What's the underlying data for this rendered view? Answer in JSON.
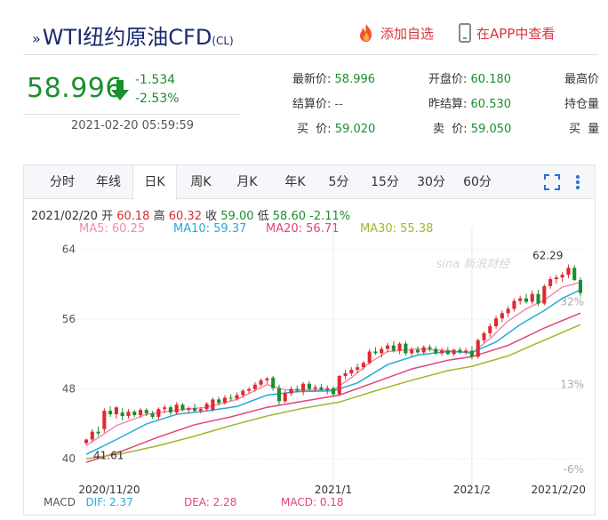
{
  "header": {
    "title_main": "WTI纽约原油CFD",
    "title_sub": "(CL)",
    "add_watch_label": "添加自选",
    "app_label": "在APP中查看"
  },
  "quote": {
    "price": "58.996",
    "change": "-1.534",
    "change_pct": "-2.53%",
    "time": "2021-02-20 05:59:59"
  },
  "fields": [
    {
      "label": "最新价:",
      "value": "58.996"
    },
    {
      "label": "开盘价:",
      "value": "60.180"
    },
    {
      "label": "最高价",
      "value": ""
    },
    {
      "label": "结算价:",
      "value": "--"
    },
    {
      "label": "昨结算:",
      "value": "60.530"
    },
    {
      "label": "持仓量",
      "value": ""
    },
    {
      "label": "买  价:",
      "value": "59.020"
    },
    {
      "label": "卖  价:",
      "value": "59.050"
    },
    {
      "label": "买  量",
      "value": ""
    }
  ],
  "tabs": [
    "分时",
    "年线",
    "日K",
    "周K",
    "月K",
    "年K",
    "5分",
    "15分",
    "30分",
    "60分"
  ],
  "active_tab": "日K",
  "info": {
    "date": "2021/02/20",
    "open_label": "开",
    "open": "60.18",
    "high_label": "高",
    "high": "60.32",
    "close_label": "收",
    "close": "59.00",
    "low_label": "低",
    "low": "58.60",
    "change_pct": "-2.11%"
  },
  "ma": [
    {
      "label": "MA5: 60.25",
      "color": "#f08bb0"
    },
    {
      "label": "MA10: 59.37",
      "color": "#27a9d9"
    },
    {
      "label": "MA20: 56.71",
      "color": "#e0457a"
    },
    {
      "label": "MA30: 55.38",
      "color": "#a3b52a"
    }
  ],
  "macd": {
    "macd_label": "MACD",
    "dif": "DIF: 2.37",
    "dea": "DEA: 2.28",
    "macd": "MACD: 0.18"
  },
  "watermark": "新浪财经",
  "chart_data": {
    "type": "candlestick",
    "ylim": [
      39.5,
      65.5
    ],
    "y_ticks": [
      "64",
      "56",
      "48",
      "40"
    ],
    "y_tick_values": [
      64,
      56,
      48,
      40
    ],
    "right_ticks": [
      "32%",
      "13%",
      "-6%"
    ],
    "x_ticks": [
      "2020/11/20",
      "2021/1",
      "2021/2",
      "2021/2/20"
    ],
    "x_tick_index": [
      0,
      41,
      64,
      93
    ],
    "annotations": {
      "high_label": "62.29",
      "low_label": "41.61"
    },
    "candles": [
      {
        "o": 41.8,
        "h": 42.3,
        "l": 41.6,
        "c": 42.2
      },
      {
        "o": 42.2,
        "h": 43.4,
        "l": 41.9,
        "c": 43.1
      },
      {
        "o": 43.1,
        "h": 43.7,
        "l": 42.6,
        "c": 42.9
      },
      {
        "o": 43.4,
        "h": 45.8,
        "l": 43.0,
        "c": 45.5
      },
      {
        "o": 45.5,
        "h": 46.0,
        "l": 44.8,
        "c": 45.1
      },
      {
        "o": 45.1,
        "h": 46.0,
        "l": 44.6,
        "c": 45.9
      },
      {
        "o": 45.3,
        "h": 45.8,
        "l": 44.4,
        "c": 44.9
      },
      {
        "o": 44.9,
        "h": 45.7,
        "l": 44.6,
        "c": 45.4
      },
      {
        "o": 45.4,
        "h": 45.6,
        "l": 44.8,
        "c": 45.0
      },
      {
        "o": 45.0,
        "h": 45.8,
        "l": 44.7,
        "c": 45.6
      },
      {
        "o": 45.6,
        "h": 45.8,
        "l": 44.9,
        "c": 45.2
      },
      {
        "o": 45.2,
        "h": 45.5,
        "l": 44.6,
        "c": 44.8
      },
      {
        "o": 44.8,
        "h": 45.9,
        "l": 44.5,
        "c": 45.7
      },
      {
        "o": 45.7,
        "h": 46.2,
        "l": 45.2,
        "c": 45.9
      },
      {
        "o": 45.9,
        "h": 46.1,
        "l": 45.0,
        "c": 45.3
      },
      {
        "o": 45.3,
        "h": 46.5,
        "l": 45.0,
        "c": 46.2
      },
      {
        "o": 46.2,
        "h": 46.4,
        "l": 45.4,
        "c": 45.6
      },
      {
        "o": 45.6,
        "h": 46.0,
        "l": 45.2,
        "c": 45.8
      },
      {
        "o": 45.8,
        "h": 46.3,
        "l": 45.3,
        "c": 45.5
      },
      {
        "o": 45.5,
        "h": 45.9,
        "l": 45.2,
        "c": 45.7
      },
      {
        "o": 45.7,
        "h": 46.5,
        "l": 45.4,
        "c": 46.3
      },
      {
        "o": 45.6,
        "h": 47.0,
        "l": 45.4,
        "c": 46.8
      },
      {
        "o": 46.8,
        "h": 47.1,
        "l": 46.1,
        "c": 46.4
      },
      {
        "o": 46.4,
        "h": 47.3,
        "l": 46.2,
        "c": 47.0
      },
      {
        "o": 47.0,
        "h": 47.4,
        "l": 46.6,
        "c": 46.9
      },
      {
        "o": 46.9,
        "h": 47.6,
        "l": 46.7,
        "c": 47.3
      },
      {
        "o": 47.3,
        "h": 48.0,
        "l": 47.0,
        "c": 47.8
      },
      {
        "o": 47.8,
        "h": 48.2,
        "l": 47.5,
        "c": 48.0
      },
      {
        "o": 48.0,
        "h": 48.8,
        "l": 47.7,
        "c": 48.5
      },
      {
        "o": 48.5,
        "h": 49.2,
        "l": 48.3,
        "c": 49.0
      },
      {
        "o": 49.0,
        "h": 49.4,
        "l": 48.6,
        "c": 49.2
      },
      {
        "o": 49.3,
        "h": 49.5,
        "l": 47.8,
        "c": 48.1
      },
      {
        "o": 48.1,
        "h": 48.5,
        "l": 46.2,
        "c": 46.6
      },
      {
        "o": 46.6,
        "h": 47.8,
        "l": 46.4,
        "c": 47.5
      },
      {
        "o": 47.5,
        "h": 48.3,
        "l": 47.2,
        "c": 48.0
      },
      {
        "o": 48.0,
        "h": 48.4,
        "l": 47.6,
        "c": 47.8
      },
      {
        "o": 47.8,
        "h": 48.8,
        "l": 47.3,
        "c": 48.6
      },
      {
        "o": 48.6,
        "h": 48.9,
        "l": 47.8,
        "c": 48.0
      },
      {
        "o": 48.0,
        "h": 48.5,
        "l": 47.7,
        "c": 48.2
      },
      {
        "o": 48.2,
        "h": 48.6,
        "l": 47.8,
        "c": 47.9
      },
      {
        "o": 47.9,
        "h": 48.4,
        "l": 47.4,
        "c": 48.1
      },
      {
        "o": 48.1,
        "h": 48.3,
        "l": 47.1,
        "c": 47.4
      },
      {
        "o": 47.4,
        "h": 49.6,
        "l": 47.2,
        "c": 49.5
      },
      {
        "o": 49.5,
        "h": 50.2,
        "l": 49.1,
        "c": 49.8
      },
      {
        "o": 49.8,
        "h": 50.5,
        "l": 49.5,
        "c": 50.2
      },
      {
        "o": 50.2,
        "h": 50.9,
        "l": 49.8,
        "c": 50.5
      },
      {
        "o": 50.5,
        "h": 51.2,
        "l": 50.2,
        "c": 51.0
      },
      {
        "o": 51.0,
        "h": 52.6,
        "l": 50.8,
        "c": 52.3
      },
      {
        "o": 52.3,
        "h": 52.8,
        "l": 51.9,
        "c": 52.1
      },
      {
        "o": 52.1,
        "h": 52.9,
        "l": 51.6,
        "c": 52.6
      },
      {
        "o": 52.6,
        "h": 53.3,
        "l": 52.2,
        "c": 53.0
      },
      {
        "o": 53.0,
        "h": 53.5,
        "l": 52.2,
        "c": 52.4
      },
      {
        "o": 52.4,
        "h": 53.4,
        "l": 52.0,
        "c": 53.2
      },
      {
        "o": 53.2,
        "h": 53.5,
        "l": 51.8,
        "c": 52.1
      },
      {
        "o": 52.1,
        "h": 52.8,
        "l": 51.7,
        "c": 52.5
      },
      {
        "o": 52.5,
        "h": 52.9,
        "l": 52.0,
        "c": 52.2
      },
      {
        "o": 52.2,
        "h": 53.0,
        "l": 51.9,
        "c": 52.8
      },
      {
        "o": 52.8,
        "h": 53.1,
        "l": 52.3,
        "c": 52.6
      },
      {
        "o": 52.6,
        "h": 52.9,
        "l": 51.9,
        "c": 52.1
      },
      {
        "o": 52.1,
        "h": 52.7,
        "l": 51.8,
        "c": 52.4
      },
      {
        "o": 52.4,
        "h": 52.8,
        "l": 51.9,
        "c": 52.0
      },
      {
        "o": 52.0,
        "h": 52.6,
        "l": 51.8,
        "c": 52.5
      },
      {
        "o": 52.5,
        "h": 52.8,
        "l": 52.0,
        "c": 52.2
      },
      {
        "o": 52.2,
        "h": 52.7,
        "l": 51.9,
        "c": 52.4
      },
      {
        "o": 52.4,
        "h": 52.9,
        "l": 51.4,
        "c": 51.7
      },
      {
        "o": 51.7,
        "h": 53.8,
        "l": 51.5,
        "c": 53.6
      },
      {
        "o": 53.6,
        "h": 54.6,
        "l": 53.3,
        "c": 54.4
      },
      {
        "o": 54.4,
        "h": 55.5,
        "l": 54.0,
        "c": 55.2
      },
      {
        "o": 55.2,
        "h": 56.4,
        "l": 54.9,
        "c": 56.1
      },
      {
        "o": 56.1,
        "h": 57.0,
        "l": 55.7,
        "c": 56.7
      },
      {
        "o": 56.7,
        "h": 57.5,
        "l": 56.2,
        "c": 57.2
      },
      {
        "o": 57.2,
        "h": 58.4,
        "l": 56.9,
        "c": 58.1
      },
      {
        "o": 58.1,
        "h": 58.7,
        "l": 57.7,
        "c": 58.4
      },
      {
        "o": 58.4,
        "h": 58.9,
        "l": 57.8,
        "c": 58.0
      },
      {
        "o": 58.0,
        "h": 59.3,
        "l": 57.7,
        "c": 58.9
      },
      {
        "o": 58.9,
        "h": 59.4,
        "l": 57.5,
        "c": 57.8
      },
      {
        "o": 57.8,
        "h": 60.0,
        "l": 57.6,
        "c": 59.8
      },
      {
        "o": 59.8,
        "h": 60.9,
        "l": 59.5,
        "c": 60.6
      },
      {
        "o": 60.6,
        "h": 61.1,
        "l": 60.1,
        "c": 60.8
      },
      {
        "o": 60.8,
        "h": 61.4,
        "l": 60.3,
        "c": 61.1
      },
      {
        "o": 61.1,
        "h": 62.29,
        "l": 60.7,
        "c": 61.9
      },
      {
        "o": 61.9,
        "h": 62.2,
        "l": 60.4,
        "c": 60.5
      },
      {
        "o": 60.5,
        "h": 60.8,
        "l": 58.6,
        "c": 59.0
      }
    ],
    "ma_lines": [
      {
        "name": "MA5",
        "color": "#f08bb0",
        "values": [
          [
            0,
            41.5
          ],
          [
            5,
            43.8
          ],
          [
            10,
            45.1
          ],
          [
            15,
            45.6
          ],
          [
            20,
            45.9
          ],
          [
            25,
            46.8
          ],
          [
            30,
            48.5
          ],
          [
            33,
            47.9
          ],
          [
            38,
            47.9
          ],
          [
            41,
            47.9
          ],
          [
            44,
            49.3
          ],
          [
            47,
            51.0
          ],
          [
            50,
            52.3
          ],
          [
            55,
            52.6
          ],
          [
            60,
            52.4
          ],
          [
            64,
            52.1
          ],
          [
            67,
            53.8
          ],
          [
            70,
            55.8
          ],
          [
            73,
            57.2
          ],
          [
            76,
            58.2
          ],
          [
            79,
            59.7
          ],
          [
            82,
            60.25
          ]
        ]
      },
      {
        "name": "MA10",
        "color": "#27a9d9",
        "values": [
          [
            0,
            40.5
          ],
          [
            5,
            42.2
          ],
          [
            10,
            44.0
          ],
          [
            15,
            45.1
          ],
          [
            20,
            45.5
          ],
          [
            25,
            46.0
          ],
          [
            30,
            47.3
          ],
          [
            35,
            47.7
          ],
          [
            41,
            47.8
          ],
          [
            45,
            48.7
          ],
          [
            50,
            50.8
          ],
          [
            55,
            51.9
          ],
          [
            60,
            52.3
          ],
          [
            64,
            52.2
          ],
          [
            68,
            53.4
          ],
          [
            72,
            55.4
          ],
          [
            76,
            57.0
          ],
          [
            79,
            58.4
          ],
          [
            82,
            59.37
          ]
        ]
      },
      {
        "name": "MA20",
        "color": "#e0457a",
        "values": [
          [
            0,
            39.6
          ],
          [
            6,
            40.9
          ],
          [
            12,
            42.5
          ],
          [
            18,
            43.9
          ],
          [
            24,
            44.8
          ],
          [
            30,
            45.9
          ],
          [
            36,
            46.6
          ],
          [
            42,
            47.3
          ],
          [
            48,
            48.8
          ],
          [
            54,
            50.3
          ],
          [
            60,
            51.3
          ],
          [
            64,
            51.7
          ],
          [
            70,
            53.0
          ],
          [
            76,
            55.0
          ],
          [
            82,
            56.71
          ]
        ]
      },
      {
        "name": "MA30",
        "color": "#a3b52a",
        "values": [
          [
            0,
            40.0
          ],
          [
            6,
            40.6
          ],
          [
            12,
            41.5
          ],
          [
            18,
            42.6
          ],
          [
            24,
            43.8
          ],
          [
            30,
            44.9
          ],
          [
            36,
            45.8
          ],
          [
            42,
            46.5
          ],
          [
            48,
            47.8
          ],
          [
            54,
            49.0
          ],
          [
            60,
            50.1
          ],
          [
            64,
            50.6
          ],
          [
            70,
            51.8
          ],
          [
            76,
            53.6
          ],
          [
            82,
            55.38
          ]
        ]
      }
    ]
  }
}
